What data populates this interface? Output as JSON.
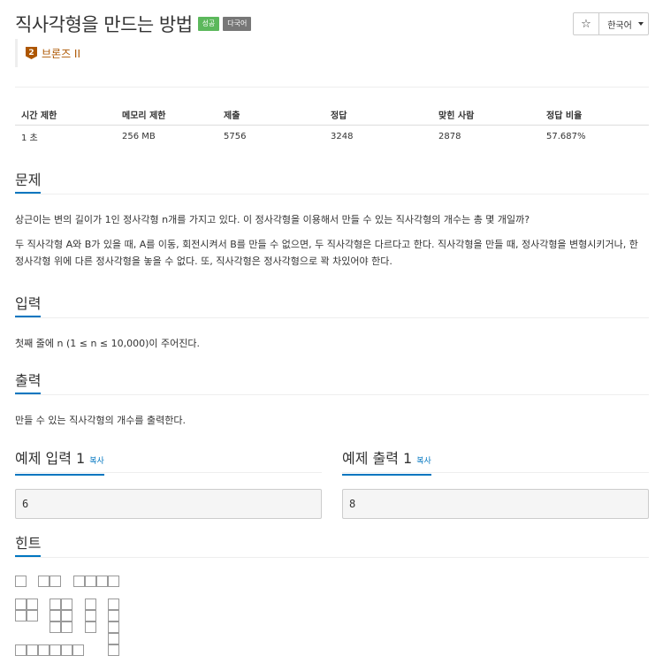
{
  "header": {
    "title": "직사각형을 만드는 방법",
    "tags": {
      "success": "성공",
      "multilang": "다국어"
    },
    "star_icon": "star-outline-icon",
    "language_button": "한국어"
  },
  "tier": {
    "number": "2",
    "name": "브론즈 II",
    "color": "#ad5600"
  },
  "stats": {
    "headers": [
      "시간 제한",
      "메모리 제한",
      "제출",
      "정답",
      "맞힌 사람",
      "정답 비율"
    ],
    "values": [
      "1 초",
      "256 MB",
      "5756",
      "3248",
      "2878",
      "57.687%"
    ]
  },
  "problem": {
    "title": "문제",
    "p1": "상근이는 변의 길이가 1인 정사각형 n개를 가지고 있다. 이 정사각형을 이용해서 만들 수 있는 직사각형의 개수는 총 몇 개일까?",
    "p2": "두 직사각형 A와 B가 있을 때, A를 이동, 회전시켜서 B를 만들 수 없으면, 두 직사각형은 다르다고 한다. 직사각형을 만들 때, 정사각형을 변형시키거나, 한 정사각형 위에 다른 정사각형을 놓을 수 없다. 또, 직사각형은 정사각형으로 꽉 차있어야 한다."
  },
  "input": {
    "title": "입력",
    "body": "첫째 줄에 n (1 ≤ n ≤ 10,000)이 주어진다."
  },
  "output": {
    "title": "출력",
    "body": "만들 수 있는 직사각형의 개수를 출력한다."
  },
  "sample_input": {
    "title": "예제 입력 1",
    "copy": "복사",
    "value": "6"
  },
  "sample_output": {
    "title": "예제 출력 1",
    "copy": "복사",
    "value": "8"
  },
  "hint": {
    "title": "힌트"
  },
  "colors": {
    "accent": "#0076c0",
    "success": "#5cb85c",
    "multilang": "#777777",
    "bronze": "#ad5600"
  }
}
